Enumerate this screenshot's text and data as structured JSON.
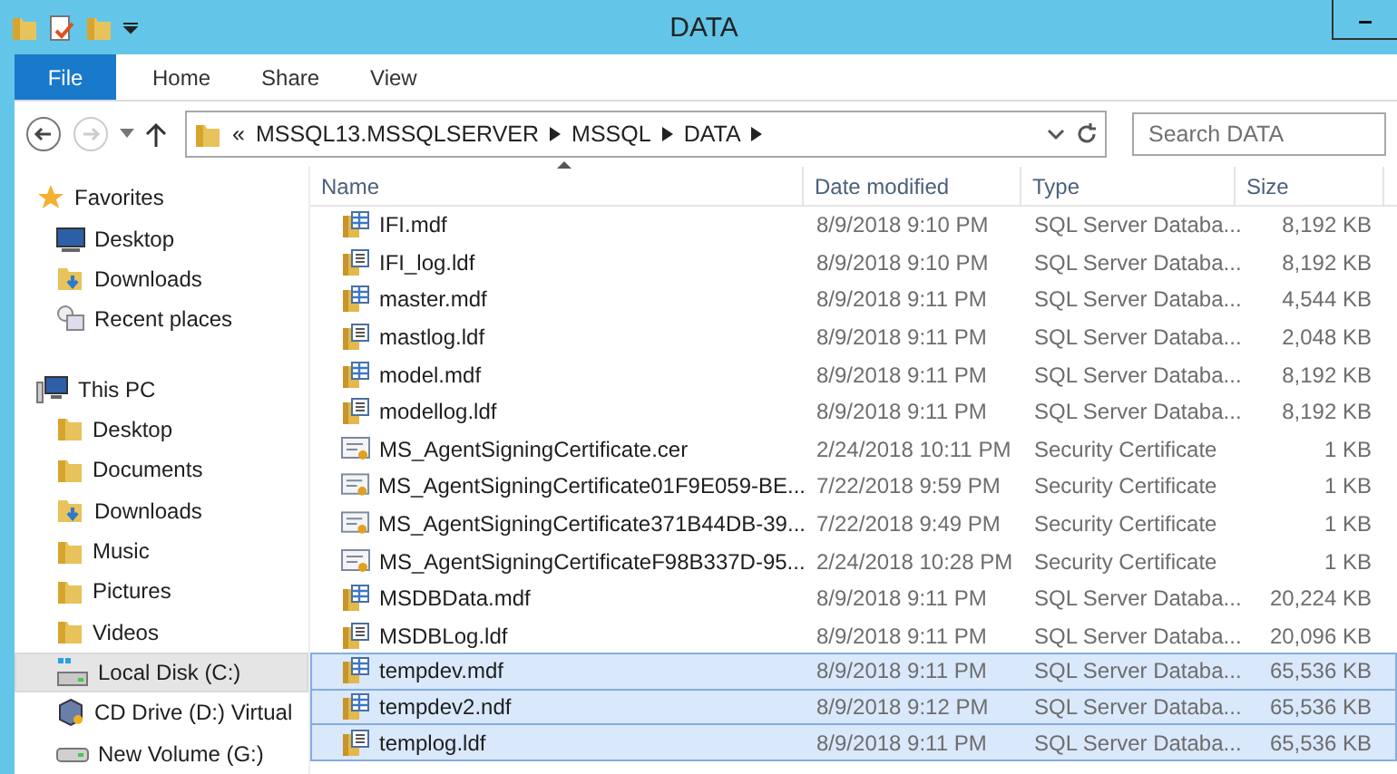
{
  "window": {
    "title": "DATA",
    "minimize_glyph": "–"
  },
  "ribbon": {
    "tabs": [
      {
        "label": "File",
        "selected": true
      },
      {
        "label": "Home",
        "selected": false
      },
      {
        "label": "Share",
        "selected": false
      },
      {
        "label": "View",
        "selected": false
      }
    ]
  },
  "address": {
    "prefix": "«",
    "crumbs": [
      "MSSQL13.MSSQLSERVER",
      "MSSQL",
      "DATA"
    ]
  },
  "search": {
    "placeholder": "Search DATA"
  },
  "sidebar": {
    "items": [
      {
        "label": "Favorites",
        "kind": "favorites",
        "selected": false
      },
      {
        "label": "Desktop",
        "kind": "desktop",
        "selected": false
      },
      {
        "label": "Downloads",
        "kind": "downloads",
        "selected": false
      },
      {
        "label": "Recent places",
        "kind": "recent",
        "selected": false
      },
      {
        "label": "This PC",
        "kind": "pc",
        "selected": false
      },
      {
        "label": "Desktop",
        "kind": "folder",
        "selected": false
      },
      {
        "label": "Documents",
        "kind": "folder",
        "selected": false
      },
      {
        "label": "Downloads",
        "kind": "downloads",
        "selected": false
      },
      {
        "label": "Music",
        "kind": "folder",
        "selected": false
      },
      {
        "label": "Pictures",
        "kind": "folder",
        "selected": false
      },
      {
        "label": "Videos",
        "kind": "folder",
        "selected": false
      },
      {
        "label": "Local Disk (C:)",
        "kind": "disk",
        "selected": true
      },
      {
        "label": "CD Drive (D:) Virtual",
        "kind": "cd",
        "selected": false
      },
      {
        "label": "New Volume (G:)",
        "kind": "volume",
        "selected": false
      }
    ]
  },
  "table": {
    "columns": [
      "Name",
      "Date modified",
      "Type",
      "Size"
    ],
    "rows": [
      {
        "name": "IFI.mdf",
        "date": "8/9/2018 9:10 PM",
        "type": "SQL Server Databa...",
        "size": "8,192 KB",
        "kind": "data",
        "selected": false
      },
      {
        "name": "IFI_log.ldf",
        "date": "8/9/2018 9:10 PM",
        "type": "SQL Server Databa...",
        "size": "8,192 KB",
        "kind": "log",
        "selected": false
      },
      {
        "name": "master.mdf",
        "date": "8/9/2018 9:11 PM",
        "type": "SQL Server Databa...",
        "size": "4,544 KB",
        "kind": "data",
        "selected": false
      },
      {
        "name": "mastlog.ldf",
        "date": "8/9/2018 9:11 PM",
        "type": "SQL Server Databa...",
        "size": "2,048 KB",
        "kind": "log",
        "selected": false
      },
      {
        "name": "model.mdf",
        "date": "8/9/2018 9:11 PM",
        "type": "SQL Server Databa...",
        "size": "8,192 KB",
        "kind": "data",
        "selected": false
      },
      {
        "name": "modellog.ldf",
        "date": "8/9/2018 9:11 PM",
        "type": "SQL Server Databa...",
        "size": "8,192 KB",
        "kind": "log",
        "selected": false
      },
      {
        "name": "MS_AgentSigningCertificate.cer",
        "date": "2/24/2018 10:11 PM",
        "type": "Security Certificate",
        "size": "1 KB",
        "kind": "certificate",
        "selected": false
      },
      {
        "name": "MS_AgentSigningCertificate01F9E059-BE...",
        "date": "7/22/2018 9:59 PM",
        "type": "Security Certificate",
        "size": "1 KB",
        "kind": "certificate",
        "selected": false
      },
      {
        "name": "MS_AgentSigningCertificate371B44DB-39...",
        "date": "7/22/2018 9:49 PM",
        "type": "Security Certificate",
        "size": "1 KB",
        "kind": "certificate",
        "selected": false
      },
      {
        "name": "MS_AgentSigningCertificateF98B337D-95...",
        "date": "2/24/2018 10:28 PM",
        "type": "Security Certificate",
        "size": "1 KB",
        "kind": "certificate",
        "selected": false
      },
      {
        "name": "MSDBData.mdf",
        "date": "8/9/2018 9:11 PM",
        "type": "SQL Server Databa...",
        "size": "20,224 KB",
        "kind": "data",
        "selected": false
      },
      {
        "name": "MSDBLog.ldf",
        "date": "8/9/2018 9:11 PM",
        "type": "SQL Server Databa...",
        "size": "20,096 KB",
        "kind": "log",
        "selected": false
      },
      {
        "name": "tempdev.mdf",
        "date": "8/9/2018 9:11 PM",
        "type": "SQL Server Databa...",
        "size": "65,536 KB",
        "kind": "data",
        "selected": true
      },
      {
        "name": "tempdev2.ndf",
        "date": "8/9/2018 9:12 PM",
        "type": "SQL Server Databa...",
        "size": "65,536 KB",
        "kind": "data",
        "selected": true
      },
      {
        "name": "templog.ldf",
        "date": "8/9/2018 9:11 PM",
        "type": "SQL Server Databa...",
        "size": "65,536 KB",
        "kind": "log",
        "selected": true
      }
    ]
  }
}
